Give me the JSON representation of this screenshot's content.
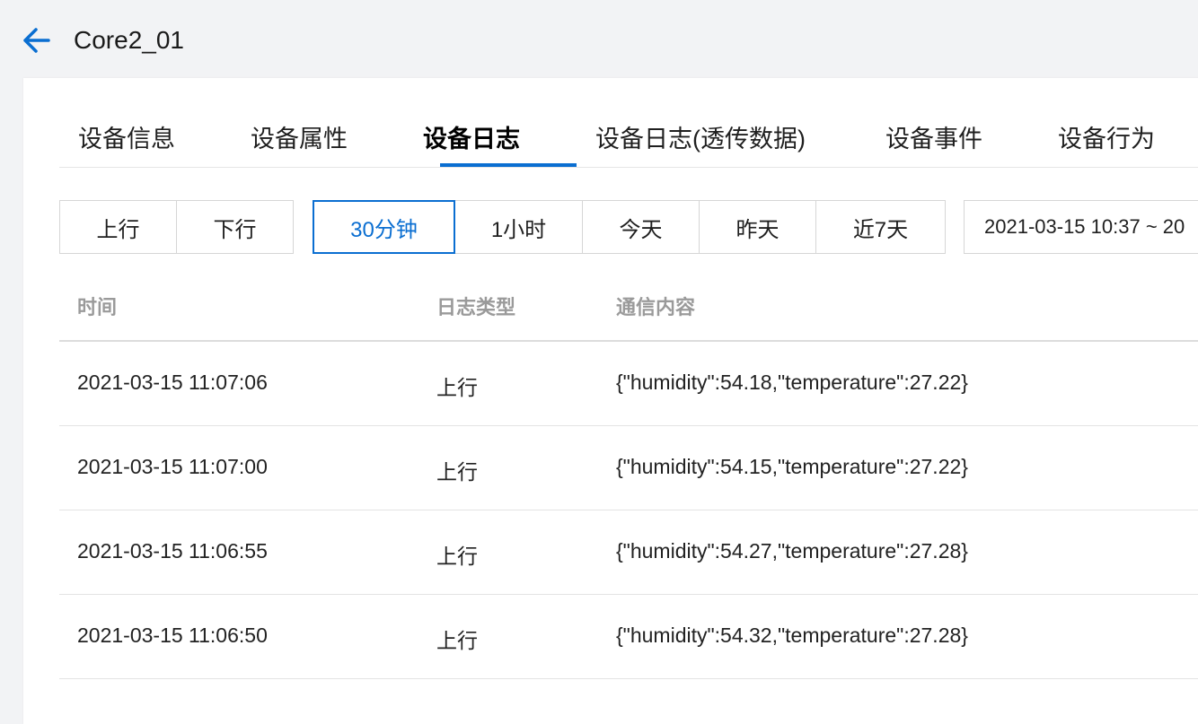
{
  "header": {
    "title": "Core2_01",
    "back_icon": "arrow-left-icon",
    "accent_color": "#0a6ed1"
  },
  "tabs": [
    {
      "label": "设备信息",
      "active": false
    },
    {
      "label": "设备属性",
      "active": false
    },
    {
      "label": "设备日志",
      "active": true
    },
    {
      "label": "设备日志(透传数据)",
      "active": false
    },
    {
      "label": "设备事件",
      "active": false
    },
    {
      "label": "设备行为",
      "active": false
    }
  ],
  "filters": {
    "direction": [
      {
        "label": "上行"
      },
      {
        "label": "下行"
      }
    ],
    "time_range": [
      {
        "label": "30分钟",
        "selected": true
      },
      {
        "label": "1小时",
        "selected": false
      },
      {
        "label": "今天",
        "selected": false
      },
      {
        "label": "昨天",
        "selected": false
      },
      {
        "label": "近7天",
        "selected": false
      }
    ],
    "date_range": "2021-03-15 10:37 ~ 20"
  },
  "table": {
    "columns": [
      "时间",
      "日志类型",
      "通信内容"
    ],
    "rows": [
      {
        "time": "2021-03-15 11:07:06",
        "type": "上行",
        "content": "{\"humidity\":54.18,\"temperature\":27.22}"
      },
      {
        "time": "2021-03-15 11:07:00",
        "type": "上行",
        "content": "{\"humidity\":54.15,\"temperature\":27.22}"
      },
      {
        "time": "2021-03-15 11:06:55",
        "type": "上行",
        "content": "{\"humidity\":54.27,\"temperature\":27.28}"
      },
      {
        "time": "2021-03-15 11:06:50",
        "type": "上行",
        "content": "{\"humidity\":54.32,\"temperature\":27.28}"
      }
    ]
  }
}
